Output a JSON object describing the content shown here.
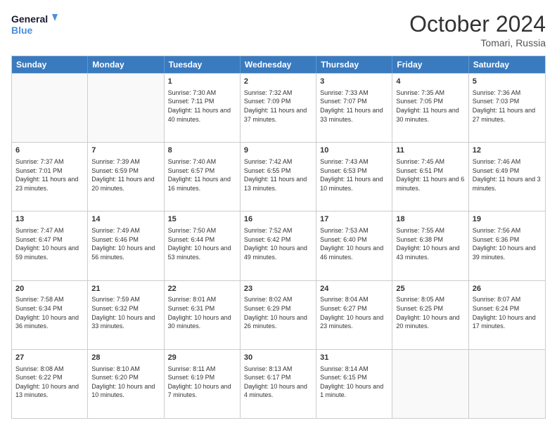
{
  "logo": {
    "line1": "General",
    "line2": "Blue"
  },
  "title": "October 2024",
  "location": "Tomari, Russia",
  "days": [
    "Sunday",
    "Monday",
    "Tuesday",
    "Wednesday",
    "Thursday",
    "Friday",
    "Saturday"
  ],
  "weeks": [
    [
      {
        "day": "",
        "info": ""
      },
      {
        "day": "",
        "info": ""
      },
      {
        "day": "1",
        "info": "Sunrise: 7:30 AM\nSunset: 7:11 PM\nDaylight: 11 hours and 40 minutes."
      },
      {
        "day": "2",
        "info": "Sunrise: 7:32 AM\nSunset: 7:09 PM\nDaylight: 11 hours and 37 minutes."
      },
      {
        "day": "3",
        "info": "Sunrise: 7:33 AM\nSunset: 7:07 PM\nDaylight: 11 hours and 33 minutes."
      },
      {
        "day": "4",
        "info": "Sunrise: 7:35 AM\nSunset: 7:05 PM\nDaylight: 11 hours and 30 minutes."
      },
      {
        "day": "5",
        "info": "Sunrise: 7:36 AM\nSunset: 7:03 PM\nDaylight: 11 hours and 27 minutes."
      }
    ],
    [
      {
        "day": "6",
        "info": "Sunrise: 7:37 AM\nSunset: 7:01 PM\nDaylight: 11 hours and 23 minutes."
      },
      {
        "day": "7",
        "info": "Sunrise: 7:39 AM\nSunset: 6:59 PM\nDaylight: 11 hours and 20 minutes."
      },
      {
        "day": "8",
        "info": "Sunrise: 7:40 AM\nSunset: 6:57 PM\nDaylight: 11 hours and 16 minutes."
      },
      {
        "day": "9",
        "info": "Sunrise: 7:42 AM\nSunset: 6:55 PM\nDaylight: 11 hours and 13 minutes."
      },
      {
        "day": "10",
        "info": "Sunrise: 7:43 AM\nSunset: 6:53 PM\nDaylight: 11 hours and 10 minutes."
      },
      {
        "day": "11",
        "info": "Sunrise: 7:45 AM\nSunset: 6:51 PM\nDaylight: 11 hours and 6 minutes."
      },
      {
        "day": "12",
        "info": "Sunrise: 7:46 AM\nSunset: 6:49 PM\nDaylight: 11 hours and 3 minutes."
      }
    ],
    [
      {
        "day": "13",
        "info": "Sunrise: 7:47 AM\nSunset: 6:47 PM\nDaylight: 10 hours and 59 minutes."
      },
      {
        "day": "14",
        "info": "Sunrise: 7:49 AM\nSunset: 6:46 PM\nDaylight: 10 hours and 56 minutes."
      },
      {
        "day": "15",
        "info": "Sunrise: 7:50 AM\nSunset: 6:44 PM\nDaylight: 10 hours and 53 minutes."
      },
      {
        "day": "16",
        "info": "Sunrise: 7:52 AM\nSunset: 6:42 PM\nDaylight: 10 hours and 49 minutes."
      },
      {
        "day": "17",
        "info": "Sunrise: 7:53 AM\nSunset: 6:40 PM\nDaylight: 10 hours and 46 minutes."
      },
      {
        "day": "18",
        "info": "Sunrise: 7:55 AM\nSunset: 6:38 PM\nDaylight: 10 hours and 43 minutes."
      },
      {
        "day": "19",
        "info": "Sunrise: 7:56 AM\nSunset: 6:36 PM\nDaylight: 10 hours and 39 minutes."
      }
    ],
    [
      {
        "day": "20",
        "info": "Sunrise: 7:58 AM\nSunset: 6:34 PM\nDaylight: 10 hours and 36 minutes."
      },
      {
        "day": "21",
        "info": "Sunrise: 7:59 AM\nSunset: 6:32 PM\nDaylight: 10 hours and 33 minutes."
      },
      {
        "day": "22",
        "info": "Sunrise: 8:01 AM\nSunset: 6:31 PM\nDaylight: 10 hours and 30 minutes."
      },
      {
        "day": "23",
        "info": "Sunrise: 8:02 AM\nSunset: 6:29 PM\nDaylight: 10 hours and 26 minutes."
      },
      {
        "day": "24",
        "info": "Sunrise: 8:04 AM\nSunset: 6:27 PM\nDaylight: 10 hours and 23 minutes."
      },
      {
        "day": "25",
        "info": "Sunrise: 8:05 AM\nSunset: 6:25 PM\nDaylight: 10 hours and 20 minutes."
      },
      {
        "day": "26",
        "info": "Sunrise: 8:07 AM\nSunset: 6:24 PM\nDaylight: 10 hours and 17 minutes."
      }
    ],
    [
      {
        "day": "27",
        "info": "Sunrise: 8:08 AM\nSunset: 6:22 PM\nDaylight: 10 hours and 13 minutes."
      },
      {
        "day": "28",
        "info": "Sunrise: 8:10 AM\nSunset: 6:20 PM\nDaylight: 10 hours and 10 minutes."
      },
      {
        "day": "29",
        "info": "Sunrise: 8:11 AM\nSunset: 6:19 PM\nDaylight: 10 hours and 7 minutes."
      },
      {
        "day": "30",
        "info": "Sunrise: 8:13 AM\nSunset: 6:17 PM\nDaylight: 10 hours and 4 minutes."
      },
      {
        "day": "31",
        "info": "Sunrise: 8:14 AM\nSunset: 6:15 PM\nDaylight: 10 hours and 1 minute."
      },
      {
        "day": "",
        "info": ""
      },
      {
        "day": "",
        "info": ""
      }
    ]
  ]
}
